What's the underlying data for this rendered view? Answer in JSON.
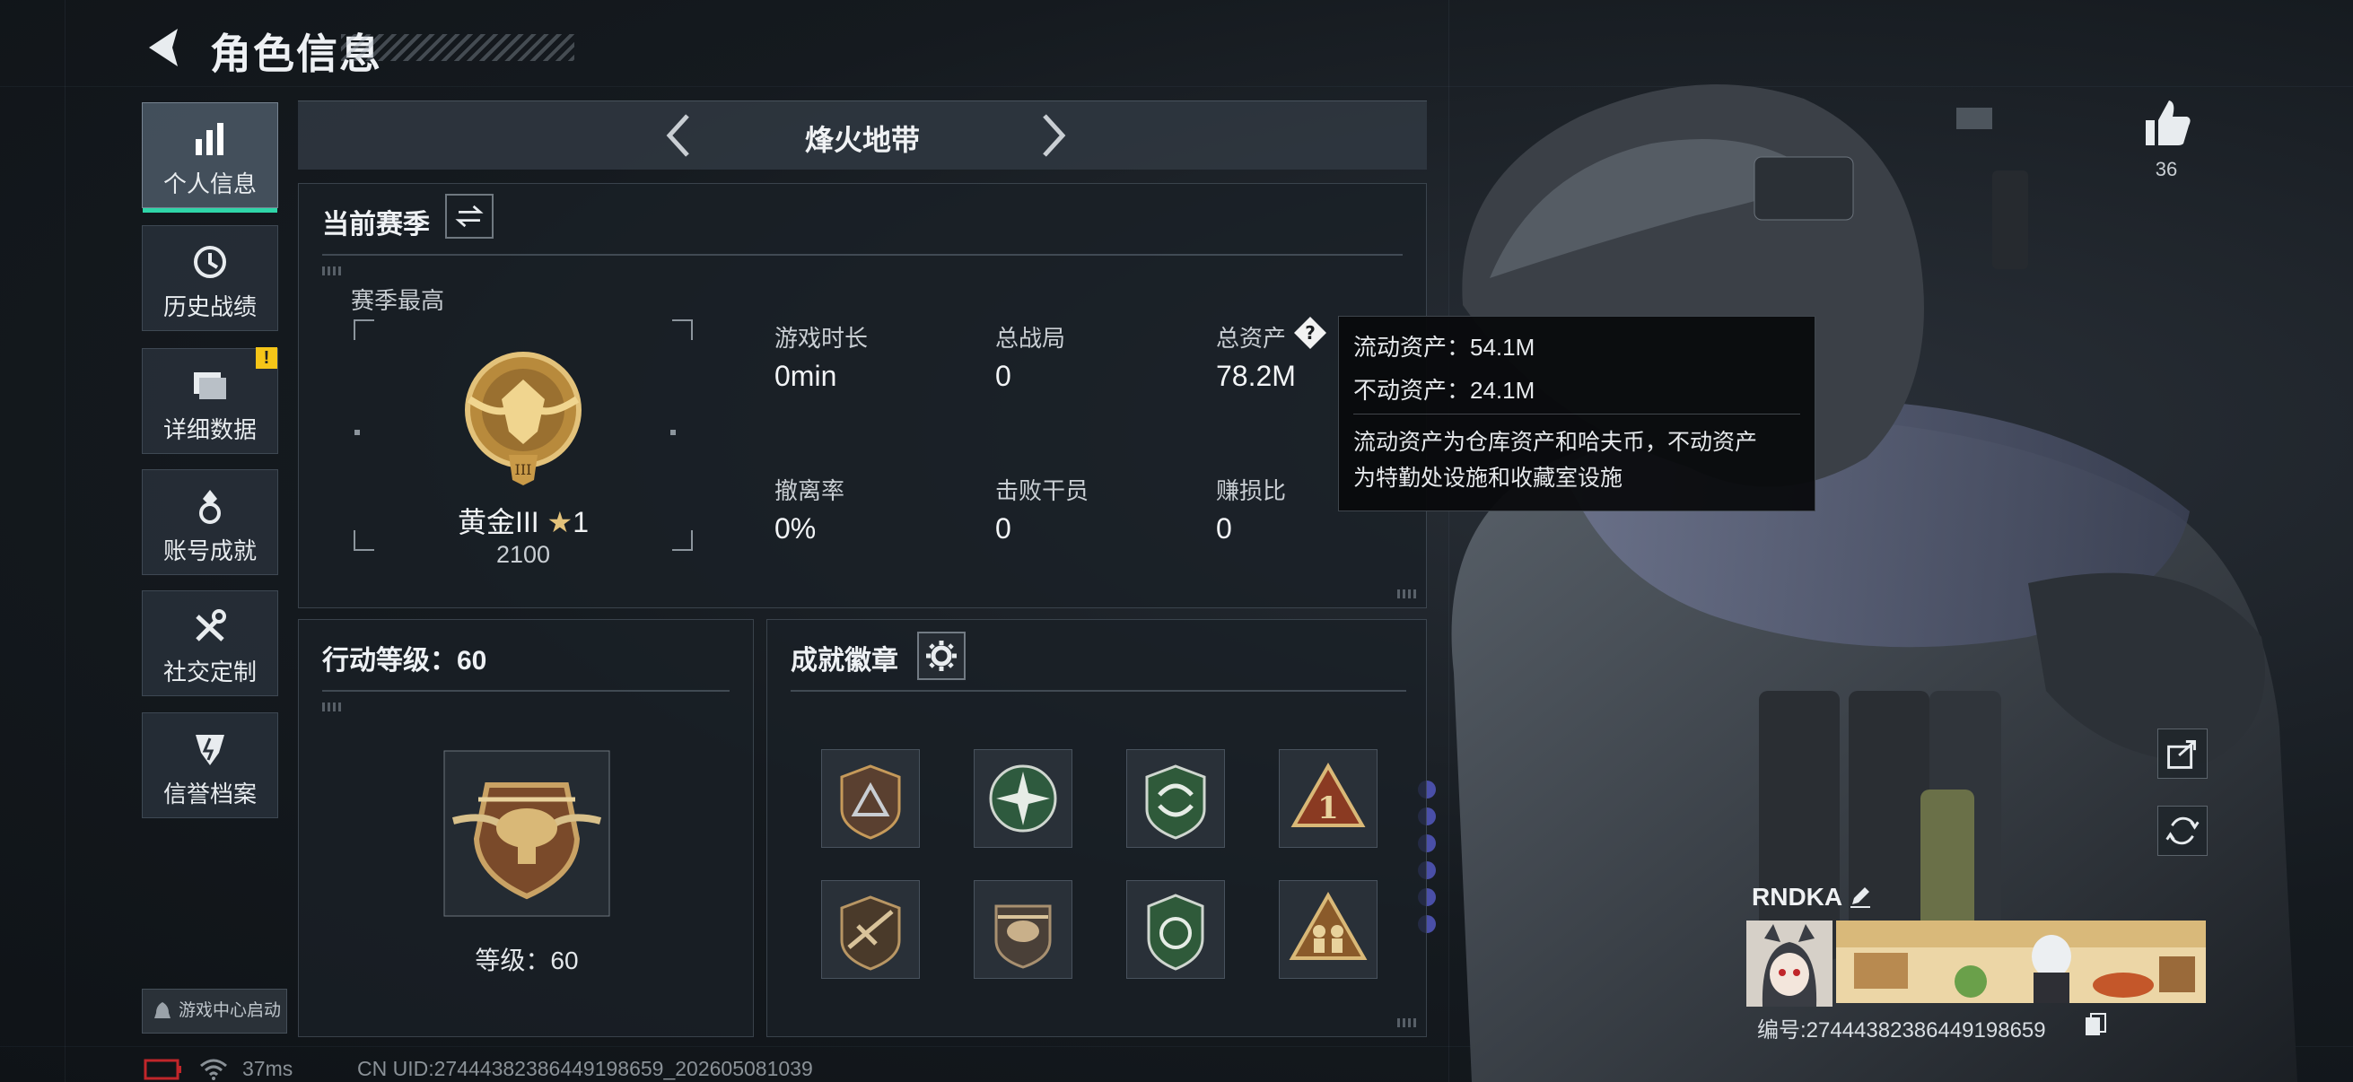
{
  "header": {
    "title": "角色信息"
  },
  "nav": {
    "items": [
      {
        "label": "个人信息",
        "icon": "bar-chart-icon",
        "active": true
      },
      {
        "label": "历史战绩",
        "icon": "history-icon"
      },
      {
        "label": "详细数据",
        "icon": "folder-icon",
        "badge": "!"
      },
      {
        "label": "账号成就",
        "icon": "medal-icon"
      },
      {
        "label": "社交定制",
        "icon": "tools-icon"
      },
      {
        "label": "信誉档案",
        "icon": "shield-icon"
      }
    ],
    "game_center": "游戏中心启动"
  },
  "mode_tabs": {
    "current": "烽火地带"
  },
  "season": {
    "title": "当前赛季",
    "best_label": "赛季最高",
    "rank_name": "黄金III",
    "rank_stars": "1",
    "rank_points": "2100",
    "stats": [
      {
        "label": "游戏时长",
        "value": "0min"
      },
      {
        "label": "总战局",
        "value": "0"
      },
      {
        "label": "总资产",
        "value": "78.2M"
      },
      {
        "label": "撤离率",
        "value": "0%"
      },
      {
        "label": "击败干员",
        "value": "0"
      },
      {
        "label": "赚损比",
        "value": "0"
      }
    ]
  },
  "tooltip": {
    "liquid": "流动资产：54.1M",
    "fixed": "不动资产：24.1M",
    "desc_line1": "流动资产为仓库资产和哈夫币，不动资产",
    "desc_line2": "为特勤处设施和收藏室设施"
  },
  "action_level": {
    "title": "行动等级：60",
    "level_text": "等级：60"
  },
  "achievements": {
    "title": "成就徽章",
    "badges": [
      "triangle-badge",
      "compass-badge",
      "arrows-badge",
      "number-one-badge",
      "rifle-badge",
      "helicopter-badge",
      "shield-badge",
      "soldiers-badge"
    ]
  },
  "social": {
    "likes": "36"
  },
  "player_card": {
    "name": "RNDKA",
    "id_text": "编号:2744438238644919865​9"
  },
  "status_bar": {
    "ping": "37ms",
    "uid": "CN UID:27444382386449198659_202605081039"
  },
  "colors": {
    "accent": "#2fd5a8",
    "badge_yellow": "#f5c518",
    "gold": "#c8a050"
  }
}
